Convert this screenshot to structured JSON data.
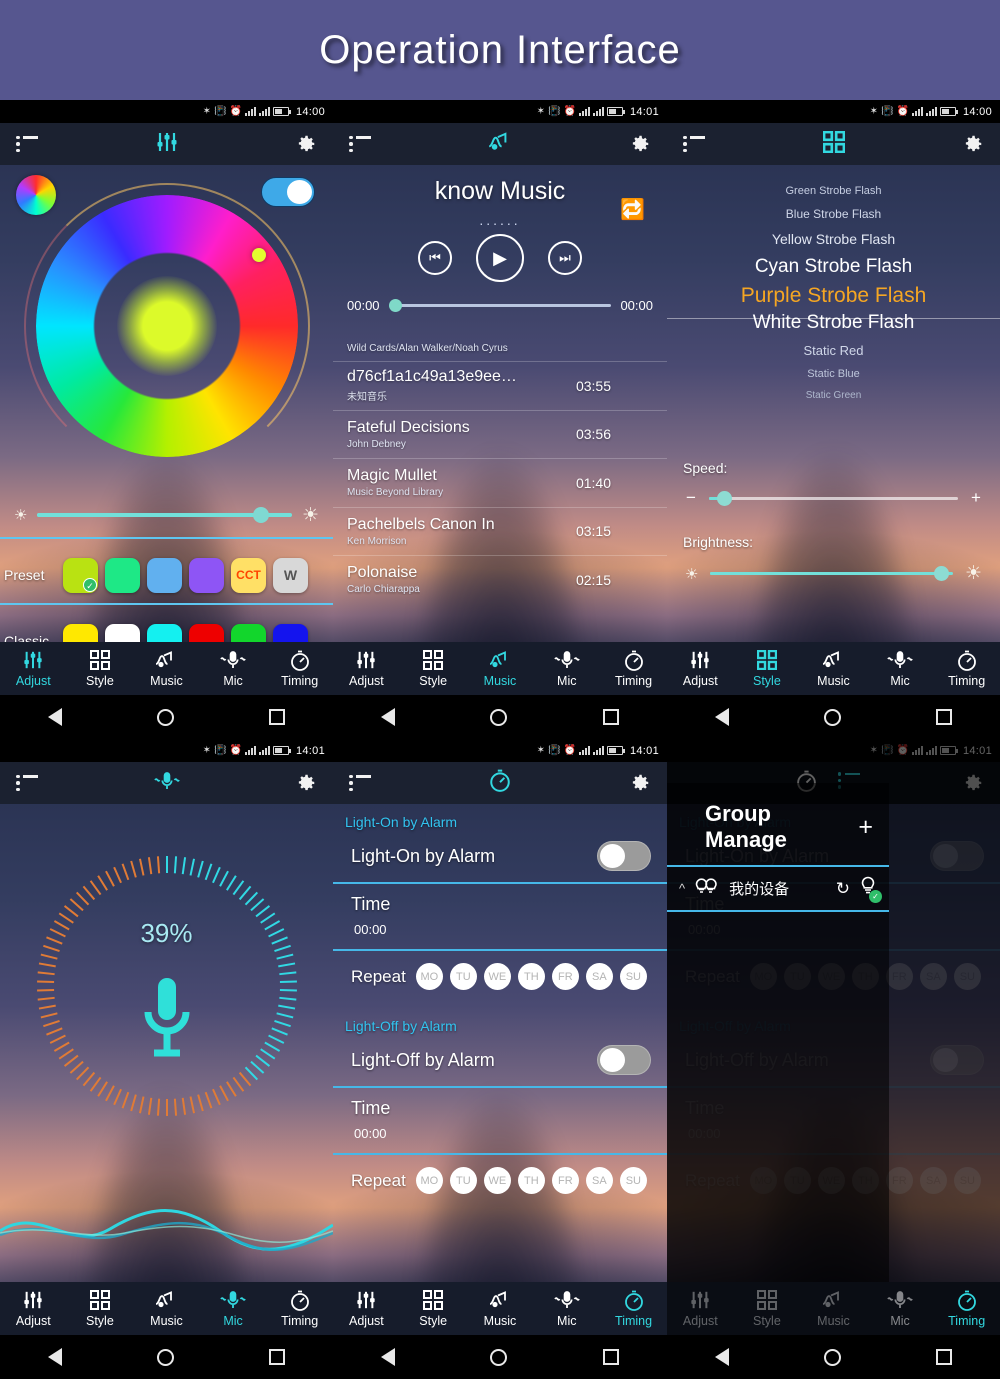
{
  "banner": {
    "title": "Operation Interface"
  },
  "statusbar": {
    "time_1400": "14:00",
    "time_1401": "14:01"
  },
  "nav": {
    "items": [
      {
        "label": "Adjust",
        "icon": "sliders-icon"
      },
      {
        "label": "Style",
        "icon": "grid-icon"
      },
      {
        "label": "Music",
        "icon": "music-wave-icon"
      },
      {
        "label": "Mic",
        "icon": "microphone-icon"
      },
      {
        "label": "Timing",
        "icon": "stopwatch-icon"
      }
    ]
  },
  "panel_adjust": {
    "toggle_on": true,
    "preset_label": "Preset",
    "classic_label": "Classic",
    "preset_swatches": [
      {
        "name": "yellow-green",
        "color": "#b9e212",
        "selected": true,
        "text": ""
      },
      {
        "name": "spring-green",
        "color": "#1ee886",
        "selected": false,
        "text": ""
      },
      {
        "name": "light-blue",
        "color": "#61b0ef",
        "selected": false,
        "text": ""
      },
      {
        "name": "purple",
        "color": "#8e55f5",
        "selected": false,
        "text": ""
      },
      {
        "name": "cct",
        "color": "#ffe066",
        "selected": false,
        "text": "CCT"
      },
      {
        "name": "white",
        "color": "#d8d8d8",
        "selected": false,
        "text": "W"
      }
    ],
    "classic_swatches": [
      {
        "name": "yellow",
        "color": "#ffe800",
        "text": ""
      },
      {
        "name": "white",
        "color": "#ffffff",
        "text": ""
      },
      {
        "name": "cyan",
        "color": "#14f0f0",
        "text": ""
      },
      {
        "name": "red",
        "color": "#ee0000",
        "text": ""
      },
      {
        "name": "green",
        "color": "#12d62c",
        "text": ""
      },
      {
        "name": "blue",
        "color": "#1414ee",
        "text": ""
      }
    ],
    "brightness_percent": 88
  },
  "panel_music": {
    "title": "know Music",
    "dots": "......",
    "time_start": "00:00",
    "time_end": "00:00",
    "now_playing_artist": "Wild Cards/Alan Walker/Noah Cyrus",
    "playlist": [
      {
        "title": "d76cf1a1c49a13e9ee…",
        "artist": "未知音乐",
        "duration": "03:55"
      },
      {
        "title": "Fateful Decisions",
        "artist": "John Debney",
        "duration": "03:56"
      },
      {
        "title": "Magic Mullet",
        "artist": "Music Beyond Library",
        "duration": "01:40"
      },
      {
        "title": "Pachelbels Canon In",
        "artist": "Ken Morrison",
        "duration": "03:15"
      },
      {
        "title": "Polonaise",
        "artist": "Carlo Chiarappa",
        "duration": "02:15"
      }
    ]
  },
  "panel_style": {
    "modes": [
      "Green Strobe Flash",
      "Blue Strobe Flash",
      "Yellow Strobe Flash",
      "Cyan Strobe Flash",
      "Purple Strobe Flash",
      "White Strobe Flash",
      "Static Red",
      "Static Blue",
      "Static Green"
    ],
    "selected_mode": "Purple Strobe Flash",
    "speed_label": "Speed:",
    "speed_minus": "−",
    "speed_plus": "+",
    "speed_percent": 6,
    "brightness_label": "Brightness:",
    "brightness_percent": 95
  },
  "panel_mic": {
    "percent_label": "39%",
    "percent_value": 39
  },
  "panel_timing": {
    "section_on": "Light-On by Alarm",
    "row_on": "Light-On by Alarm",
    "section_off": "Light-Off by Alarm",
    "row_off": "Light-Off by Alarm",
    "time_label": "Time",
    "time_value": "00:00",
    "repeat_label": "Repeat",
    "days": [
      "MO",
      "TU",
      "WE",
      "TH",
      "FR",
      "SA",
      "SU"
    ]
  },
  "panel_group": {
    "title": "Group Manage",
    "add": "+",
    "device_name": "我的设备"
  },
  "colors": {
    "accent_cyan": "#32d8e0",
    "accent_orange": "#f5a623",
    "banner_bg": "#56568f",
    "section_cyan": "#32c4f0"
  }
}
